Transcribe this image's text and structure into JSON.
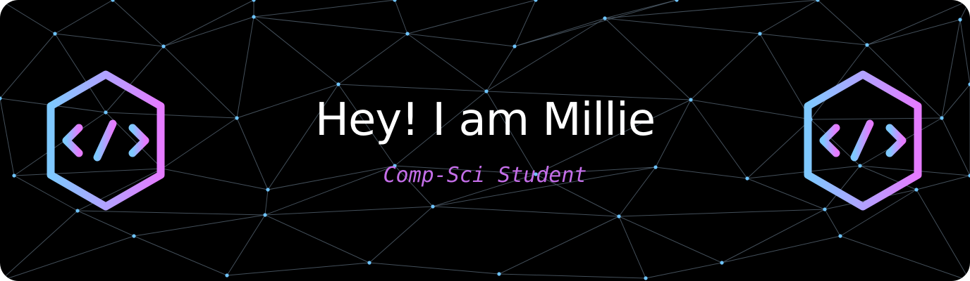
{
  "banner": {
    "title": "Hey! I am Millie",
    "subtitle": "Comp-Sci Student",
    "colors": {
      "background": "#000000",
      "title": "#ffffff",
      "subtitle": "#c46ee8",
      "network_line": "#5a6a78",
      "network_node": "#6ec4ff",
      "icon_gradient_start": "#7ec9ff",
      "icon_gradient_end": "#e57bff"
    },
    "icons": {
      "left": "code-hexagon-icon",
      "right": "code-hexagon-icon"
    }
  }
}
